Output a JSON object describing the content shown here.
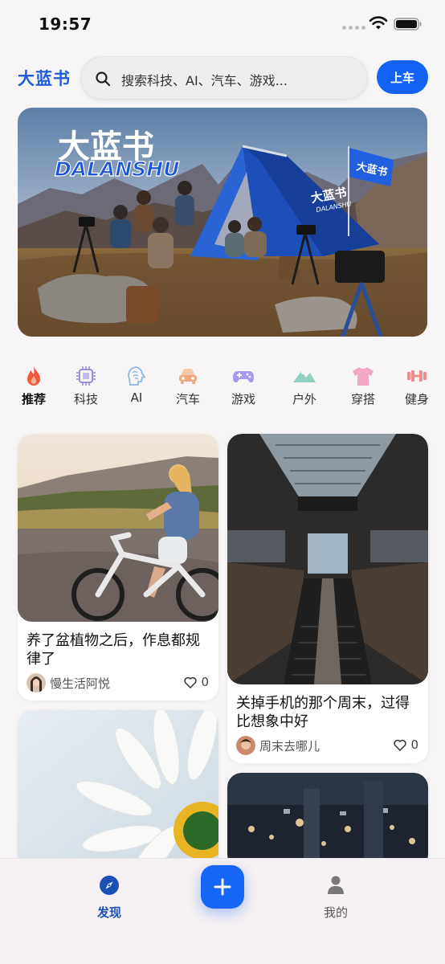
{
  "status_bar": {
    "time": "19:57"
  },
  "header": {
    "logo": "大蓝书",
    "search_placeholder": "搜索科技、AI、汽车、游戏...",
    "board_button": "上车"
  },
  "banner": {
    "title": "大蓝书",
    "subtitle": "DALANSHU",
    "tent_text": "大蓝书",
    "tent_subtext": "DALANSHU",
    "flag_text": "大蓝书"
  },
  "categories": [
    {
      "label": "推荐",
      "icon": "flame-icon",
      "active": true
    },
    {
      "label": "科技",
      "icon": "chip-icon"
    },
    {
      "label": "AI",
      "icon": "brain-icon"
    },
    {
      "label": "汽车",
      "icon": "car-icon"
    },
    {
      "label": "游戏",
      "icon": "gamepad-icon"
    },
    {
      "label": "户外",
      "icon": "mountain-icon"
    },
    {
      "label": "穿搭",
      "icon": "tshirt-icon"
    },
    {
      "label": "健身",
      "icon": "dumbbell-icon"
    }
  ],
  "feed": [
    {
      "title": "养了盆植物之后，作息都规律了",
      "author": "慢生活阿悦",
      "likes": "0"
    },
    {
      "title": "关掉手机的那个周末，过得比想象中好",
      "author": "周末去哪儿",
      "likes": "0"
    }
  ],
  "bottom_nav": {
    "discover": "发现",
    "mine": "我的"
  },
  "colors": {
    "accent": "#1263f5",
    "logo": "#1f5cd8",
    "nav_active": "#1a4fb5"
  }
}
